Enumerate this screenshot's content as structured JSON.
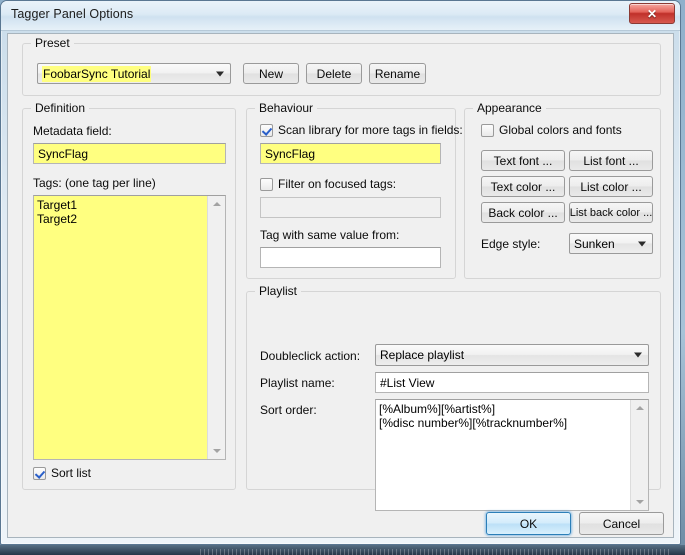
{
  "window": {
    "title": "Tagger Panel Options",
    "close_label": "✕"
  },
  "preset": {
    "legend": "Preset",
    "combo_value": "FoobarSync Tutorial",
    "buttons": {
      "new": "New",
      "delete": "Delete",
      "rename": "Rename"
    }
  },
  "definition": {
    "legend": "Definition",
    "metadata_field_label": "Metadata field:",
    "metadata_field_value": "SyncFlag",
    "tags_label": "Tags: (one tag per line)",
    "tags_value": "Target1\nTarget2",
    "sort_list_label": "Sort list",
    "sort_list_checked": true
  },
  "behaviour": {
    "legend": "Behaviour",
    "scan_library_label": "Scan library for more tags in fields:",
    "scan_library_checked": true,
    "scan_library_value": "SyncFlag",
    "filter_focused_label": "Filter on focused tags:",
    "filter_focused_checked": false,
    "filter_focused_value": "",
    "tag_same_value_label": "Tag with same value from:",
    "tag_same_value_value": ""
  },
  "appearance": {
    "legend": "Appearance",
    "global_colors_label": "Global colors and fonts",
    "global_colors_checked": false,
    "buttons": {
      "text_font": "Text font ...",
      "list_font": "List font ...",
      "text_color": "Text color ...",
      "list_color": "List color ...",
      "back_color": "Back color ...",
      "list_back_color": "List back color ..."
    },
    "edge_style_label": "Edge style:",
    "edge_style_value": "Sunken"
  },
  "playlist": {
    "legend": "Playlist",
    "doubleclick_label": "Doubleclick action:",
    "doubleclick_value": "Replace playlist",
    "playlist_name_label": "Playlist name:",
    "playlist_name_value": "#List View",
    "sort_order_label": "Sort order:",
    "sort_order_value": "[%Album%][%artist%]\n[%disc number%][%tracknumber%]"
  },
  "footer": {
    "ok_label": "OK",
    "cancel_label": "Cancel"
  },
  "colors": {
    "highlight_yellow": "#ffff80",
    "accent_blue": "#2c7fb8",
    "close_red": "#c0302a"
  }
}
